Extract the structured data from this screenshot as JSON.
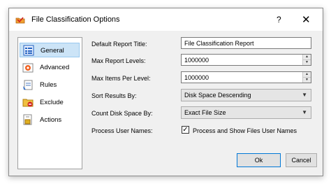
{
  "window": {
    "title": "File Classification Options",
    "help": "?",
    "close": "✕"
  },
  "sidebar": {
    "items": [
      {
        "label": "General",
        "icon": "general-icon"
      },
      {
        "label": "Advanced",
        "icon": "advanced-icon"
      },
      {
        "label": "Rules",
        "icon": "rules-icon"
      },
      {
        "label": "Exclude",
        "icon": "exclude-icon"
      },
      {
        "label": "Actions",
        "icon": "actions-icon"
      }
    ]
  },
  "form": {
    "default_report_title": {
      "label": "Default Report Title:",
      "value": "File Classification Report"
    },
    "max_report_levels": {
      "label": "Max Report Levels:",
      "value": "1000000"
    },
    "max_items_per_level": {
      "label": "Max Items Per Level:",
      "value": "1000000"
    },
    "sort_results_by": {
      "label": "Sort Results By:",
      "value": "Disk Space Descending"
    },
    "count_disk_space_by": {
      "label": "Count Disk Space By:",
      "value": "Exact File Size"
    },
    "process_user_names": {
      "label": "Process User Names:",
      "checkbox_label": "Process and Show Files User Names",
      "checked": true
    }
  },
  "buttons": {
    "ok": "Ok",
    "cancel": "Cancel"
  }
}
